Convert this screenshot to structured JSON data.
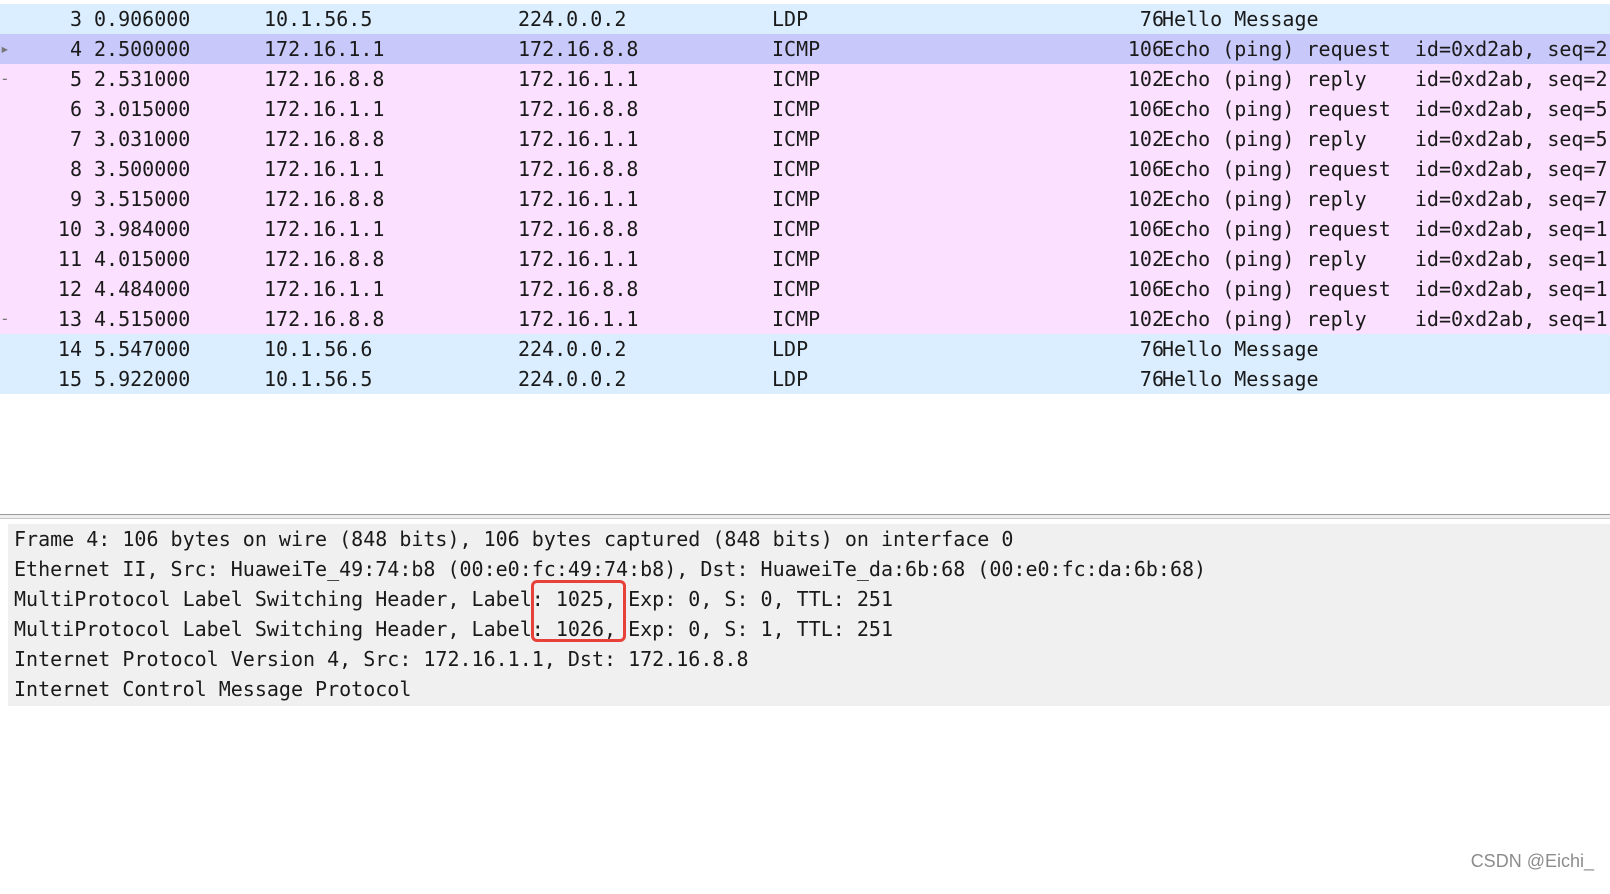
{
  "packet_list": {
    "rows": [
      {
        "no": "3",
        "time": "0.906000",
        "src": "10.1.56.5",
        "dst": "224.0.0.2",
        "proto": "LDP",
        "len": "76",
        "info": "Hello Message",
        "type": "ldp",
        "marker": ""
      },
      {
        "no": "4",
        "time": "2.500000",
        "src": "172.16.1.1",
        "dst": "172.16.8.8",
        "proto": "ICMP",
        "len": "106",
        "info": "Echo (ping) request  id=0xd2ab, seq=2",
        "type": "selected",
        "marker": "▸"
      },
      {
        "no": "5",
        "time": "2.531000",
        "src": "172.16.8.8",
        "dst": "172.16.1.1",
        "proto": "ICMP",
        "len": "102",
        "info": "Echo (ping) reply    id=0xd2ab, seq=2",
        "type": "icmp",
        "marker": "-"
      },
      {
        "no": "6",
        "time": "3.015000",
        "src": "172.16.1.1",
        "dst": "172.16.8.8",
        "proto": "ICMP",
        "len": "106",
        "info": "Echo (ping) request  id=0xd2ab, seq=5",
        "type": "icmp",
        "marker": ""
      },
      {
        "no": "7",
        "time": "3.031000",
        "src": "172.16.8.8",
        "dst": "172.16.1.1",
        "proto": "ICMP",
        "len": "102",
        "info": "Echo (ping) reply    id=0xd2ab, seq=5",
        "type": "icmp",
        "marker": ""
      },
      {
        "no": "8",
        "time": "3.500000",
        "src": "172.16.1.1",
        "dst": "172.16.8.8",
        "proto": "ICMP",
        "len": "106",
        "info": "Echo (ping) request  id=0xd2ab, seq=7",
        "type": "icmp",
        "marker": ""
      },
      {
        "no": "9",
        "time": "3.515000",
        "src": "172.16.8.8",
        "dst": "172.16.1.1",
        "proto": "ICMP",
        "len": "102",
        "info": "Echo (ping) reply    id=0xd2ab, seq=7",
        "type": "icmp",
        "marker": ""
      },
      {
        "no": "10",
        "time": "3.984000",
        "src": "172.16.1.1",
        "dst": "172.16.8.8",
        "proto": "ICMP",
        "len": "106",
        "info": "Echo (ping) request  id=0xd2ab, seq=1",
        "type": "icmp",
        "marker": ""
      },
      {
        "no": "11",
        "time": "4.015000",
        "src": "172.16.8.8",
        "dst": "172.16.1.1",
        "proto": "ICMP",
        "len": "102",
        "info": "Echo (ping) reply    id=0xd2ab, seq=1",
        "type": "icmp",
        "marker": ""
      },
      {
        "no": "12",
        "time": "4.484000",
        "src": "172.16.1.1",
        "dst": "172.16.8.8",
        "proto": "ICMP",
        "len": "106",
        "info": "Echo (ping) request  id=0xd2ab, seq=1",
        "type": "icmp",
        "marker": ""
      },
      {
        "no": "13",
        "time": "4.515000",
        "src": "172.16.8.8",
        "dst": "172.16.1.1",
        "proto": "ICMP",
        "len": "102",
        "info": "Echo (ping) reply    id=0xd2ab, seq=1",
        "type": "icmp",
        "marker": "-"
      },
      {
        "no": "14",
        "time": "5.547000",
        "src": "10.1.56.6",
        "dst": "224.0.0.2",
        "proto": "LDP",
        "len": "76",
        "info": "Hello Message",
        "type": "ldp",
        "marker": ""
      },
      {
        "no": "15",
        "time": "5.922000",
        "src": "10.1.56.5",
        "dst": "224.0.0.2",
        "proto": "LDP",
        "len": "76",
        "info": "Hello Message",
        "type": "ldp",
        "marker": ""
      }
    ]
  },
  "details": {
    "lines": [
      "Frame 4: 106 bytes on wire (848 bits), 106 bytes captured (848 bits) on interface 0",
      "Ethernet II, Src: HuaweiTe_49:74:b8 (00:e0:fc:49:74:b8), Dst: HuaweiTe_da:6b:68 (00:e0:fc:da:6b:68)",
      "MultiProtocol Label Switching Header, Label: 1025, Exp: 0, S: 0, TTL: 251",
      "MultiProtocol Label Switching Header, Label: 1026, Exp: 0, S: 1, TTL: 251",
      "Internet Protocol Version 4, Src: 172.16.1.1, Dst: 172.16.8.8",
      "Internet Control Message Protocol"
    ]
  },
  "colors": {
    "ldp_row": "#daeeff",
    "icmp_row": "#fce0ff",
    "selected_row": "#c8c8fa",
    "annotation": "#e8413a"
  },
  "watermark": "CSDN @Eichi_"
}
